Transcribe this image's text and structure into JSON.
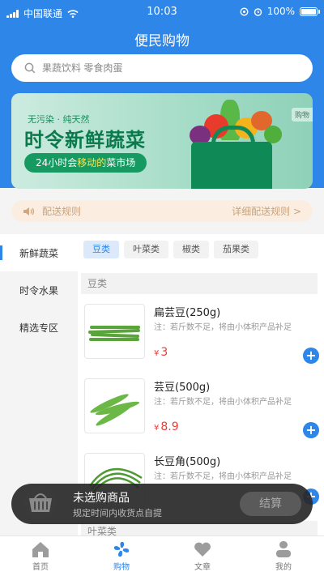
{
  "status_bar": {
    "carrier": "中国联通",
    "time": "10:03",
    "battery": "100%"
  },
  "header": {
    "title": "便民购物"
  },
  "search": {
    "placeholder": "果蔬饮料 零食肉蛋"
  },
  "banner": {
    "small_text": "无污染 · 纯天然",
    "headline": "时令新鲜蔬菜",
    "pill_prefix": "24小时会",
    "pill_highlight": "移动的",
    "pill_suffix": "菜市场",
    "corner_tag": "购物"
  },
  "notice": {
    "left_label": "配送规则",
    "right_link": "详细配送规则 >"
  },
  "sidebar": {
    "items": [
      {
        "label": "新鲜蔬菜",
        "active": true
      },
      {
        "label": "时令水果",
        "active": false
      },
      {
        "label": "精选专区",
        "active": false
      }
    ]
  },
  "tabs": [
    {
      "label": "豆类",
      "active": true
    },
    {
      "label": "叶菜类",
      "active": false
    },
    {
      "label": "椒类",
      "active": false
    },
    {
      "label": "茄果类",
      "active": false
    }
  ],
  "groups": [
    {
      "title": "豆类"
    },
    {
      "title": "叶菜类"
    }
  ],
  "products": [
    {
      "name": "扁芸豆(250g)",
      "note": "注：若斤数不足，将由小体积产品补足",
      "currency": "¥",
      "price": "3"
    },
    {
      "name": "芸豆(500g)",
      "note": "注：若斤数不足，将由小体积产品补足",
      "currency": "¥",
      "price": "8.9"
    },
    {
      "name": "长豆角(500g)",
      "note": "注：若斤数不足，将由小体积产品补足",
      "currency": "¥",
      "price": ""
    }
  ],
  "cart": {
    "title": "未选购商品",
    "subtitle": "规定时间内收货点自提",
    "checkout_label": "结算"
  },
  "tabbar": {
    "items": [
      {
        "label": "首页",
        "icon": "home-icon"
      },
      {
        "label": "购物",
        "icon": "fan-icon"
      },
      {
        "label": "文章",
        "icon": "heart-icon"
      },
      {
        "label": "我的",
        "icon": "user-icon"
      }
    ],
    "active_index": 1
  },
  "colors": {
    "primary": "#2e86e8",
    "price": "#e4413b",
    "banner_green": "#0a7a4c"
  }
}
